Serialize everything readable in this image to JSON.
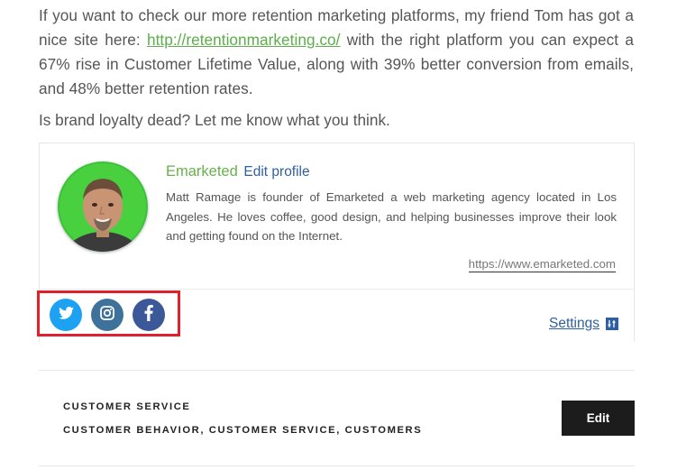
{
  "article": {
    "para1_before_link": "If you want to check our more retention marketing platforms, my friend Tom has got a nice site here: ",
    "para1_link": "http://retentionmarketing.co/",
    "para1_after_link": " with the right platform you can expect a 67% rise in Customer Lifetime Value, along with 39% better conversion from emails, and 48% better retention rates.",
    "para2": "Is brand loyalty dead? Let me know what you think."
  },
  "author": {
    "name": "Emarketed",
    "edit_profile_label": "Edit profile",
    "bio": "Matt Ramage is founder of Emarketed a web marketing agency located in Los Angeles. He loves coffee, good design, and helping businesses improve their look and getting found on the Internet.",
    "url": "https://www.emarketed.com",
    "settings_label": "Settings",
    "social": [
      {
        "name": "twitter-icon",
        "color": "#1da1f2"
      },
      {
        "name": "instagram-icon",
        "color": "#3f729b"
      },
      {
        "name": "facebook-icon",
        "color": "#3b5998"
      }
    ],
    "highlight_color": "#e0202a"
  },
  "tags": {
    "category": "CUSTOMER SERVICE",
    "tags": "CUSTOMER BEHAVIOR, CUSTOMER SERVICE, CUSTOMERS"
  },
  "edit_button_label": "Edit"
}
